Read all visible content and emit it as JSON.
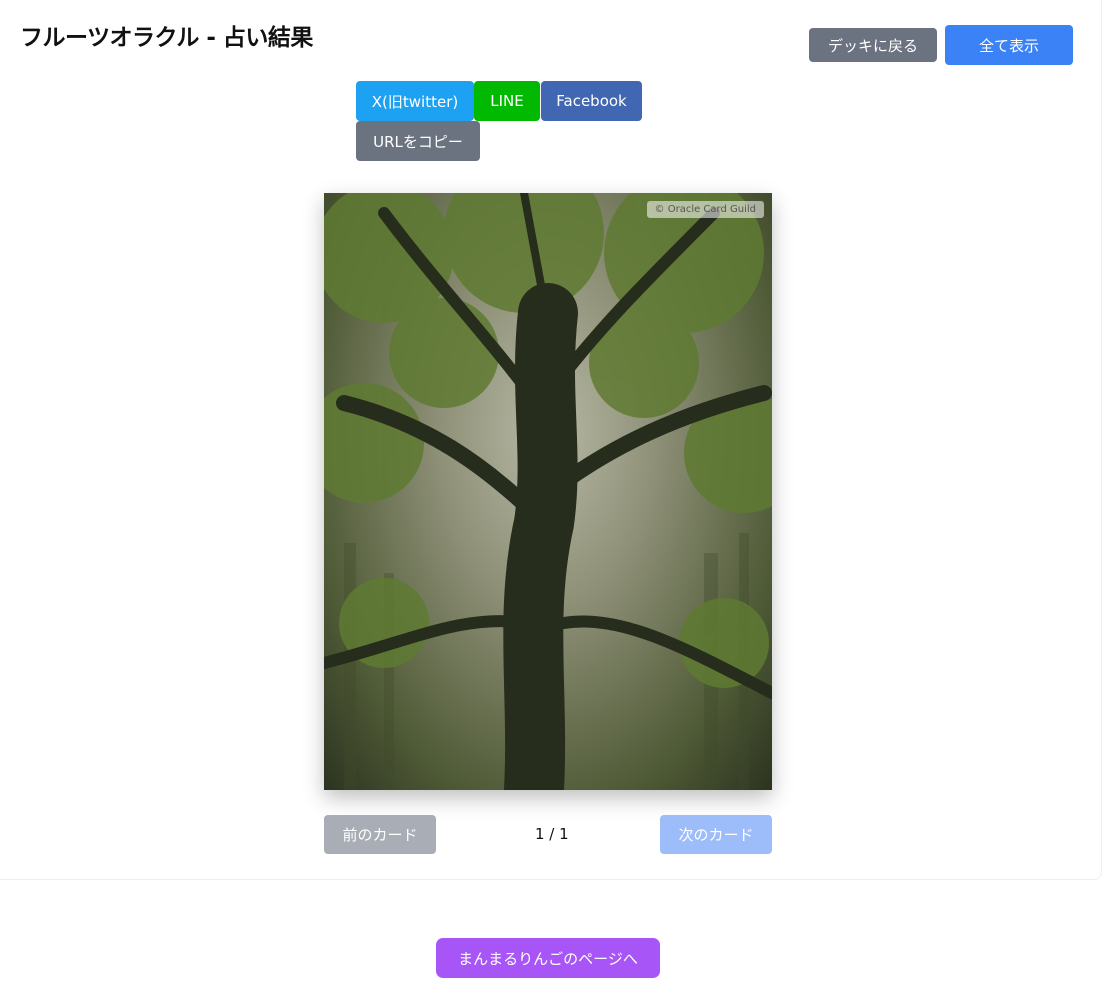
{
  "header": {
    "title": "フルーツオラクル - 占い結果",
    "back_label": "デッキに戻る",
    "show_all_label": "全て表示"
  },
  "share": {
    "x_label": "X(旧twitter)",
    "line_label": "LINE",
    "facebook_label": "Facebook",
    "copy_label": "URLをコピー"
  },
  "card": {
    "credit": "© Oracle Card Guild",
    "image_icon": "oak-tree-image"
  },
  "nav": {
    "prev_label": "前のカード",
    "next_label": "次のカード",
    "page": "1 / 1"
  },
  "footer": {
    "link_label": "まんまるりんごのページへ"
  },
  "colors": {
    "gray": "#6b7280",
    "blue": "#3b82f6",
    "x": "#1da1f2",
    "line": "#00b900",
    "facebook": "#4267b2",
    "purple": "#a855f7"
  }
}
